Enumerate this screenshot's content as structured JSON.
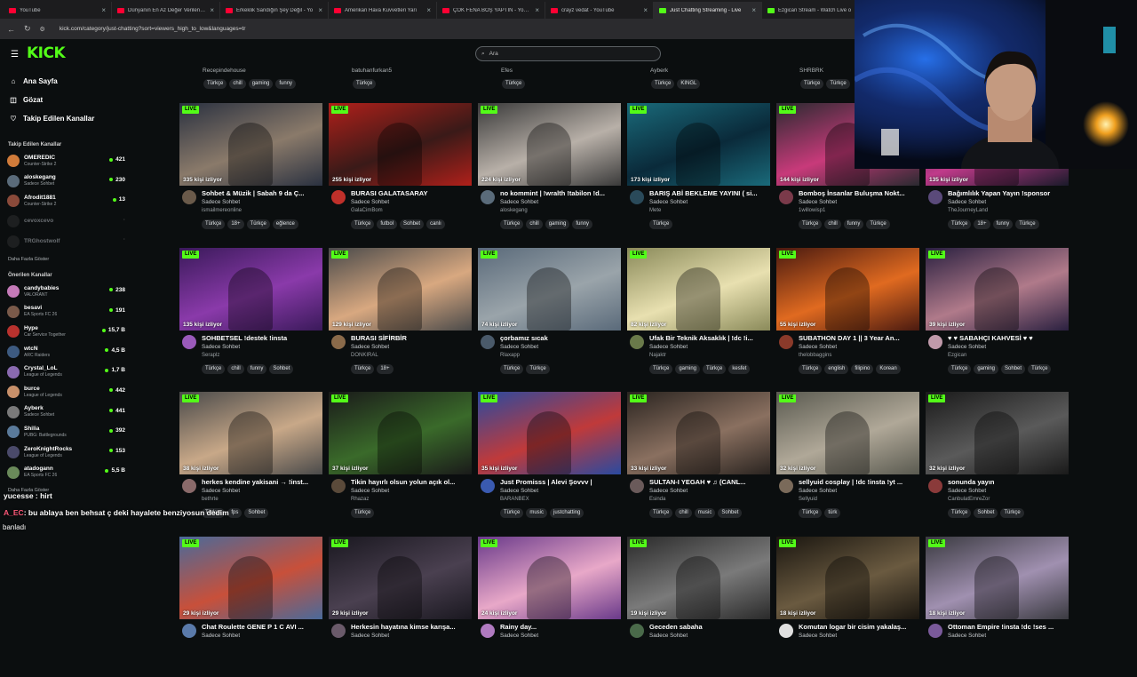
{
  "browser": {
    "tabs": [
      {
        "title": "YouTube",
        "color": "#ff0033",
        "active": false
      },
      {
        "title": "Dünyanın En Az Değer Verilen | Yo",
        "color": "#ff0033",
        "active": false
      },
      {
        "title": "Erkeklik Sandığın Şey Değil - Yo",
        "color": "#ff0033",
        "active": false
      },
      {
        "title": "Amerikan Hava Kuvvetleri Yarı",
        "color": "#ff0033",
        "active": false
      },
      {
        "title": "ÇOK FENA BOŞ YAPTIN - YouTu",
        "color": "#ff0033",
        "active": false
      },
      {
        "title": "crayz vedat - YouTube",
        "color": "#ff0033",
        "active": false
      },
      {
        "title": "Just Chatting Streaming - Live",
        "color": "#53fc18",
        "active": true
      },
      {
        "title": "Ezgican Stream - Watch Live o",
        "color": "#53fc18",
        "active": false
      }
    ],
    "url": "kick.com/category/just-chatting?sort=viewers_high_to_low&languages=tr"
  },
  "header": {
    "logo": "KICK",
    "search_placeholder": "Ara"
  },
  "sidebar": {
    "nav": [
      {
        "label": "Ana Sayfa",
        "icon": "home-icon",
        "glyph": "⌂"
      },
      {
        "label": "Gözat",
        "icon": "browse-icon",
        "glyph": "◫"
      },
      {
        "label": "Takip Edilen Kanallar",
        "icon": "heart-icon",
        "glyph": "♡"
      }
    ],
    "followed_title": "Takip Edilen Kanallar",
    "followed": [
      {
        "name": "OMEREDIC",
        "game": "Counter-Strike 2",
        "viewers": "421",
        "color": "#d07b3a",
        "online": true
      },
      {
        "name": "aloskegang",
        "game": "Sadece Sohbet",
        "viewers": "230",
        "color": "#5a6b7a",
        "online": true
      },
      {
        "name": "Afrodit1881",
        "game": "Counter-Strike 2",
        "viewers": "13",
        "color": "#8a4a3a",
        "online": true
      },
      {
        "name": "cevoxcevo",
        "game": "",
        "viewers": "",
        "color": "#3a3a3a",
        "online": false
      },
      {
        "name": "TRGhostwolf",
        "game": "",
        "viewers": "",
        "color": "#3a3a3a",
        "online": false
      }
    ],
    "followed_more": "Daha Fazla Göster",
    "suggested_title": "Önerilen Kanallar",
    "suggested": [
      {
        "name": "candybabies",
        "game": "VALORANT",
        "viewers": "238",
        "color": "#c47ab8"
      },
      {
        "name": "besavi",
        "game": "EA Sports FC 26",
        "viewers": "191",
        "color": "#7a5a4a"
      },
      {
        "name": "Hype",
        "game": "Car Service Together",
        "viewers": "15,7 B",
        "color": "#b8322e"
      },
      {
        "name": "wtcN",
        "game": "ARC Raiders",
        "viewers": "4,5 B",
        "color": "#3d5a80"
      },
      {
        "name": "Crystal_LoL",
        "game": "League of Legends",
        "viewers": "1,7 B",
        "color": "#8a6ab0"
      },
      {
        "name": "burce",
        "game": "League of Legends",
        "viewers": "442",
        "color": "#c8906a"
      },
      {
        "name": "Ayberk",
        "game": "Sadece Sohbet",
        "viewers": "441",
        "color": "#7a7a7a"
      },
      {
        "name": "Shilia",
        "game": "PUBG: Battlegrounds",
        "viewers": "392",
        "color": "#5a7a9a"
      },
      {
        "name": "ZeroKnightRocks",
        "game": "League of Legends",
        "viewers": "153",
        "color": "#4a4a6a"
      },
      {
        "name": "atadogann",
        "game": "EA Sports FC 26",
        "viewers": "5,5 B",
        "color": "#6a8a5a"
      }
    ],
    "suggested_more": "Daha Fazla Göster"
  },
  "chat_overlay": {
    "line1": "yucesse : hirt",
    "line2_user": "A_EC",
    "line2_text": ": bu ablaya ben behsat ç deki hayalete benziyosun dedim",
    "line3": "banladı"
  },
  "top_strip": [
    {
      "streamer": "Recepindehouse",
      "tags": [
        "Türkçe",
        "chill",
        "gaming",
        "funny"
      ]
    },
    {
      "streamer": "batuhanfurkan5",
      "tags": [
        "Türkçe"
      ]
    },
    {
      "streamer": "Efes",
      "tags": [
        "Türkçe"
      ]
    },
    {
      "streamer": "Ayberk",
      "tags": [
        "Türkçe",
        "KINGL"
      ]
    },
    {
      "streamer": "SHRBRK",
      "tags": [
        "Türkçe",
        "Türkçe"
      ]
    }
  ],
  "live_badge": "LIVE",
  "streams": [
    [
      {
        "viewers": "335 kişi izliyor",
        "title": "Sohbet & Müzik | Sabah 9 da Ç...",
        "category": "Sadece Sohbet",
        "streamer": "ismailmereonline",
        "tags": [
          "Türkçe",
          "18+",
          "Türkçe",
          "eğlence"
        ],
        "c1": "#2a3140",
        "c2": "#8a7a6a",
        "av": "#6a5a4a"
      },
      {
        "viewers": "255 kişi izliyor",
        "title": "BURASI GALATASARAY",
        "category": "Sadece Sohbet",
        "streamer": "GalaCimBom",
        "tags": [
          "Türkçe",
          "futbol",
          "Sohbet",
          "canlı"
        ],
        "c1": "#b0201a",
        "c2": "#3a1a18",
        "av": "#c0302a"
      },
      {
        "viewers": "224 kişi izliyor",
        "title": "no kommint | !wralth !tabilon !d...",
        "category": "Sadece Sohbet",
        "streamer": "aloskegang",
        "tags": [
          "Türkçe",
          "chill",
          "gaming",
          "funny"
        ],
        "c1": "#3a3a3a",
        "c2": "#b8b0a8",
        "av": "#5a6b7a"
      },
      {
        "viewers": "173 kişi izliyor",
        "title": "BARIŞ ABİ BEKLEME YAYINI ( si...",
        "category": "Sadece Sohbet",
        "streamer": "Mete",
        "tags": [
          "Türkçe"
        ],
        "c1": "#1a6a7a",
        "c2": "#0a2a3a",
        "av": "#2a4a5a"
      },
      {
        "viewers": "144 kişi izliyor",
        "title": "Bomboş İnsanlar Buluşma Nokt...",
        "category": "Sadece Sohbet",
        "streamer": "1willowisp1",
        "tags": [
          "Türkçe",
          "chill",
          "funny",
          "Türkçe"
        ],
        "c1": "#2a2a30",
        "c2": "#c83a7a",
        "av": "#7a3a4a"
      },
      {
        "viewers": "135 kişi izliyor",
        "title": "Bağımlılık Yapan Yayın !sponsor",
        "category": "Sadece Sohbet",
        "streamer": "TheJourneyLand",
        "tags": [
          "Türkçe",
          "18+",
          "funny",
          "Türkçe"
        ],
        "c1": "#1a1a2a",
        "c2": "#c03a8a",
        "av": "#5a4a7a"
      }
    ],
    [
      {
        "viewers": "135 kişi izliyor",
        "title": "SOHBETSEL !destek !insta",
        "category": "Sadece Sohbet",
        "streamer": "Seraplz",
        "tags": [
          "Türkçe",
          "chill",
          "funny",
          "Sohbet"
        ],
        "c1": "#3a1a5a",
        "c2": "#8a3aaa",
        "av": "#9a5aba"
      },
      {
        "viewers": "129 kişi izliyor",
        "title": "BURASI SİFİRBİR",
        "category": "Sadece Sohbet",
        "streamer": "DONKIRAL",
        "tags": [
          "Türkçe",
          "18+"
        ],
        "c1": "#4a4a4a",
        "c2": "#d8a880",
        "av": "#8a6a4a"
      },
      {
        "viewers": "74 kişi izliyor",
        "title": "çorbamız sıcak",
        "category": "Sadece Sohbet",
        "streamer": "Rlaxapp",
        "tags": [
          "Türkçe",
          "Türkçe"
        ],
        "c1": "#5a6a7a",
        "c2": "#9aa4aa",
        "av": "#4a5a6a"
      },
      {
        "viewers": "82 kişi izliyor",
        "title": "Ufak Bir Teknik Aksaklık | !dc !i...",
        "category": "Sadece Sohbet",
        "streamer": "Najaktr",
        "tags": [
          "Türkçe",
          "gaming",
          "Türkçe",
          "kesfet"
        ],
        "c1": "#8a8a5a",
        "c2": "#e8e0b0",
        "av": "#6a7a4a"
      },
      {
        "viewers": "55 kişi izliyor",
        "title": "SUBATHON DAY 1 || 3 Year An...",
        "category": "Sadece Sohbet",
        "streamer": "thelobbaggins",
        "tags": [
          "Türkçe",
          "english",
          "filipino",
          "Korean"
        ],
        "c1": "#4a1a10",
        "c2": "#e06a20",
        "av": "#8a3a2a"
      },
      {
        "viewers": "39 kişi izliyor",
        "title": "♥ ♥ SABAHÇI KAHVESİ ♥ ♥",
        "category": "Sadece Sohbet",
        "streamer": "Ezgican",
        "tags": [
          "Türkçe",
          "gaming",
          "Sohbet",
          "Türkçe"
        ],
        "c1": "#2a2040",
        "c2": "#b07a8a",
        "av": "#c09aaa"
      }
    ],
    [
      {
        "viewers": "38 kişi izliyor",
        "title": "herkes kendine yakisani → !inst...",
        "category": "Sadece Sohbet",
        "streamer": "bethrte",
        "tags": [
          "Türkçe",
          "fps",
          "Sohbet"
        ],
        "c1": "#4a4a4a",
        "c2": "#c8a888",
        "av": "#8a6a6a"
      },
      {
        "viewers": "37 kişi izliyor",
        "title": "Tikin hayırlı olsun yolun açık ol...",
        "category": "Sadece Sohbet",
        "streamer": "Rhazaz",
        "tags": [
          "Türkçe"
        ],
        "c1": "#1a1a1a",
        "c2": "#3a6a2a",
        "av": "#5a4a3a"
      },
      {
        "viewers": "35 kişi izliyor",
        "title": "Just Promisss | Alevi Şovvv |",
        "category": "Sadece Sohbet",
        "streamer": "BARANBEX",
        "tags": [
          "Türkçe",
          "music",
          "justchatting"
        ],
        "c1": "#2a4aa0",
        "c2": "#c03a3a",
        "av": "#3a5ab0"
      },
      {
        "viewers": "33 kişi izliyor",
        "title": "SULTAN-I YEGAH ♥ ♫ (CANL...",
        "category": "Sadece Sohbet",
        "streamer": "Esinda",
        "tags": [
          "Türkçe",
          "chill",
          "music",
          "Sohbet"
        ],
        "c1": "#2a2420",
        "c2": "#8a7060",
        "av": "#6a5a5a"
      },
      {
        "viewers": "32 kişi izliyor",
        "title": "sellyuid cosplay | !dc !insta !yt ...",
        "category": "Sadece Sohbet",
        "streamer": "Sellyuid",
        "tags": [
          "Türkçe",
          "türk"
        ],
        "c1": "#5a5a50",
        "c2": "#b0a898",
        "av": "#7a6a5a"
      },
      {
        "viewers": "32 kişi izliyor",
        "title": "sonunda yayın",
        "category": "Sadece Sohbet",
        "streamer": "CanbulatEmreZor",
        "tags": [
          "Türkçe",
          "Sohbet",
          "Türkçe"
        ],
        "c1": "#1a1a1a",
        "c2": "#5a5a5a",
        "av": "#8a3a3a"
      }
    ],
    [
      {
        "viewers": "29 kişi izliyor",
        "title": "Chat Roulette GENE P 1 C AVI ...",
        "category": "Sadece Sohbet",
        "streamer": "",
        "tags": [],
        "c1": "#4a6a9a",
        "c2": "#c8503a",
        "av": "#5a7aaa"
      },
      {
        "viewers": "29 kişi izliyor",
        "title": "Herkesin hayatına kimse karışa...",
        "category": "Sadece Sohbet",
        "streamer": "",
        "tags": [],
        "c1": "#1a1820",
        "c2": "#4a4050",
        "av": "#6a5a6a"
      },
      {
        "viewers": "24 kişi izliyor",
        "title": "Rainy day...",
        "category": "Sadece Sohbet",
        "streamer": "",
        "tags": [],
        "c1": "#6a3a8a",
        "c2": "#e8a8c8",
        "av": "#b07ac0"
      },
      {
        "viewers": "19 kişi izliyor",
        "title": "Geceden sabaha",
        "category": "Sadece Sohbet",
        "streamer": "",
        "tags": [],
        "c1": "#2a2a2a",
        "c2": "#7a7a7a",
        "av": "#4a6a4a"
      },
      {
        "viewers": "18 kişi izliyor",
        "title": "Komutan logar bir cisim yakalaş...",
        "category": "Sadece Sohbet",
        "streamer": "",
        "tags": [],
        "c1": "#1a1610",
        "c2": "#6a5a40",
        "av": "#e0e0e0"
      },
      {
        "viewers": "18 kişi izliyor",
        "title": "Ottoman Empire !insta !dc !ses ...",
        "category": "Sadece Sohbet",
        "streamer": "",
        "tags": [],
        "c1": "#3a3a40",
        "c2": "#a090b0",
        "av": "#7a5a9a"
      }
    ]
  ]
}
